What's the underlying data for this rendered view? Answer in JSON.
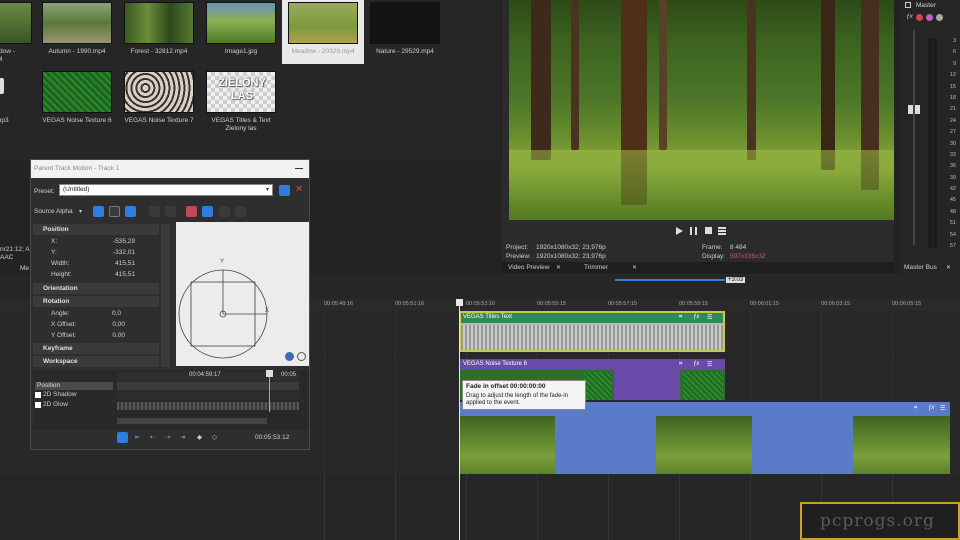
{
  "media_bin": {
    "items": [
      {
        "label": "...adow - \nmp4"
      },
      {
        "label": "Autumn - 1990.mp4"
      },
      {
        "label": "Forest - 32812.mp4"
      },
      {
        "label": "Image1.jpg"
      },
      {
        "label": "Meadow - 20329.mp4"
      },
      {
        "label": "Nature - 29529.mp4"
      },
      {
        "label": "mp3"
      },
      {
        "label": "VEGAS Noise Texture 6"
      },
      {
        "label": "VEGAS Noise Texture 7"
      },
      {
        "label": "VEGAS Titles & Text\nZielony las"
      }
    ],
    "title_thumb_text": "ZIELONY\nLAS"
  },
  "preview": {
    "project_label": "Project:",
    "project_value": "1920x1080x32; 23,976p",
    "preview_label": "Preview:",
    "preview_value": "1920x1080x32; 23,976p",
    "frame_label": "Frame:",
    "frame_value": "8 484",
    "display_label": "Display:",
    "display_value": "597x336x32",
    "tab_video_preview": "Video Preview",
    "tab_trimmer": "Trimmer"
  },
  "master": {
    "title": "Master",
    "scale": [
      "3",
      "6",
      "9",
      "12",
      "15",
      "18",
      "21",
      "24",
      "27",
      "30",
      "33",
      "36",
      "39",
      "42",
      "45",
      "48",
      "51",
      "54",
      "57"
    ],
    "footer": "Master Bus"
  },
  "dialog": {
    "title": "Parent Track Motion - Track 1",
    "preset_label": "Preset:",
    "preset_value": "(Untitled)",
    "source_alpha_label": "Source Alpha",
    "position_head": "Position",
    "x_label": "X:",
    "x_value": "-535,29",
    "y_label": "Y:",
    "y_value": "-332,01",
    "width_label": "Width:",
    "width_value": "415,51",
    "height_label": "Height:",
    "height_value": "415,51",
    "orientation_head": "Orientation",
    "rotation_head": "Rotation",
    "angle_label": "Angle:",
    "angle_value": "0,0",
    "xoffset_label": "X Offset:",
    "xoffset_value": "0,00",
    "yoffset_label": "Y Offset:",
    "yoffset_value": "0,00",
    "keyframe_head": "Keyframe",
    "workspace_head": "Workspace",
    "kf_tracks": [
      "Position",
      "2D Shadow",
      "2D Glow"
    ],
    "kf_time": "00:04:59:17",
    "kf_time_end": "00:05",
    "bottom_time": "00:05:53:12",
    "axis_x": "X",
    "axis_y": "Y"
  },
  "left_partial": {
    "line1": "nr21:12; A",
    "line2": "AAC",
    "line3": "Me"
  },
  "timeline": {
    "position_marker": "+3:03",
    "ruler": [
      "00:05:49:16",
      "00:05:51:16",
      "00:05:53:16",
      "00:05:55:15",
      "00:05:57:15",
      "00:05:59:15",
      "00:06:01:15",
      "00:06:03:15",
      "00:06:05:15"
    ],
    "clip_titles": "VEGAS Titles Text",
    "clip_noise": "VEGAS Noise Texture 6",
    "tooltip_title": "Fade in offset 00:00:00:00",
    "tooltip_body": "Drag to adjust the length of the fade-in applied to the event."
  },
  "watermark": {
    "text": "pcprogs.org"
  },
  "colors": {
    "accent_blue": "#2f7de0",
    "clip_green": "#2f8a55",
    "clip_purple": "#6a4aa8",
    "clip_blue": "#5a7cc8",
    "title_border": "#c8c84a"
  }
}
